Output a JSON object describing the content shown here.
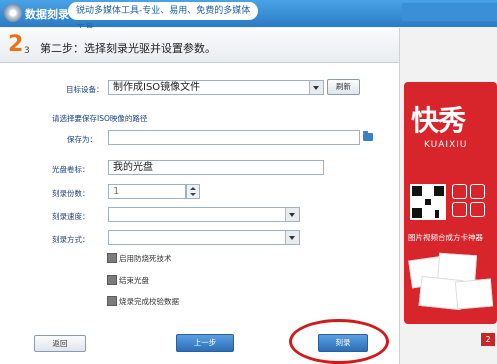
{
  "header": {
    "app_title": "数据刻录",
    "tagline": "锐动多媒体工具-专业、易用、免费的多媒体工具"
  },
  "step": {
    "number": "2",
    "sub": "3",
    "title": "第二步：选择刻录光驱并设置参数。"
  },
  "form": {
    "target_device_label": "目标设备：",
    "target_device_value": "制作成ISO镜像文件",
    "browse_button": "刷新",
    "save_path_hint": "请选择要保存ISO映像的路径",
    "save_as_label": "保存为：",
    "save_as_value": "",
    "disc_label_label": "光盘卷标：",
    "disc_label_value": "我的光盘",
    "copies_label": "刻录份数：",
    "copies_value": "1",
    "speed_label": "刻录速度：",
    "speed_value": "",
    "mode_label": "刻录方式：",
    "mode_value": "",
    "opt_burnproof": "启用防烧死技术",
    "opt_finalize": "结束光盘",
    "opt_verify": "烧录完成校验数据"
  },
  "buttons": {
    "back": "返回",
    "prev": "上一步",
    "burn": "刻录"
  },
  "ad": {
    "logo": "快秀",
    "sub": "KUAIXIU",
    "slogan": "图片视频合成方卡神器"
  },
  "badge": "2"
}
